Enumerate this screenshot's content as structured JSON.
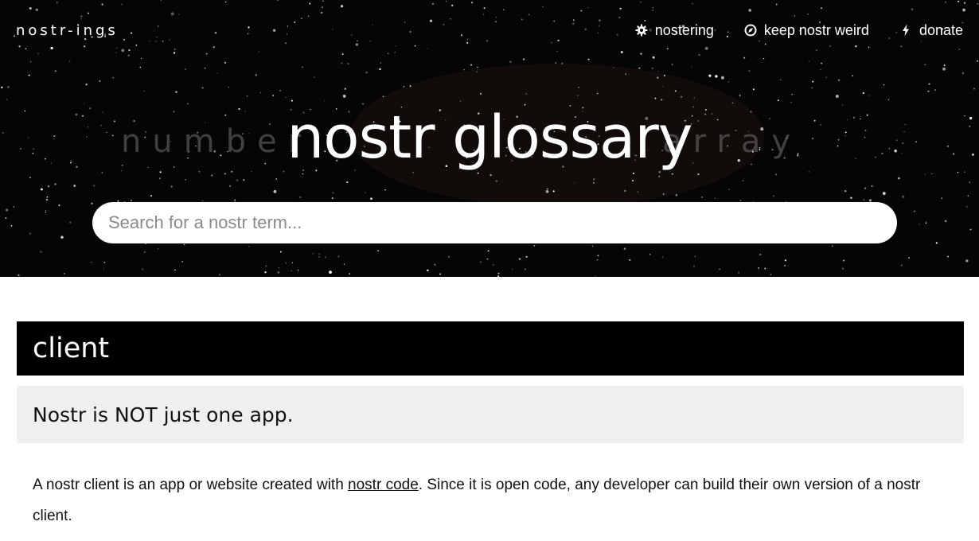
{
  "nav": {
    "brand": "nostr-ings",
    "links": [
      {
        "icon": "gear-icon",
        "label": "nostering"
      },
      {
        "icon": "compass-icon",
        "label": "keep nostr weird"
      },
      {
        "icon": "lightning-icon",
        "label": "donate"
      }
    ]
  },
  "hero": {
    "title": "nostr glossary",
    "background_words": [
      "number",
      "array"
    ],
    "search": {
      "placeholder": "Search for a nostr term...",
      "value": ""
    }
  },
  "term": {
    "name": "client",
    "summary": "Nostr is NOT just one app.",
    "body_before": "A nostr client is an app or website created with ",
    "body_link": "nostr code",
    "body_after": ". Since it is open code, any developer can build their own version of a nostr client."
  },
  "colors": {
    "hero_bg": "#050505",
    "header_bg": "#000000",
    "summary_bg": "#efefef",
    "text": "#111111"
  }
}
